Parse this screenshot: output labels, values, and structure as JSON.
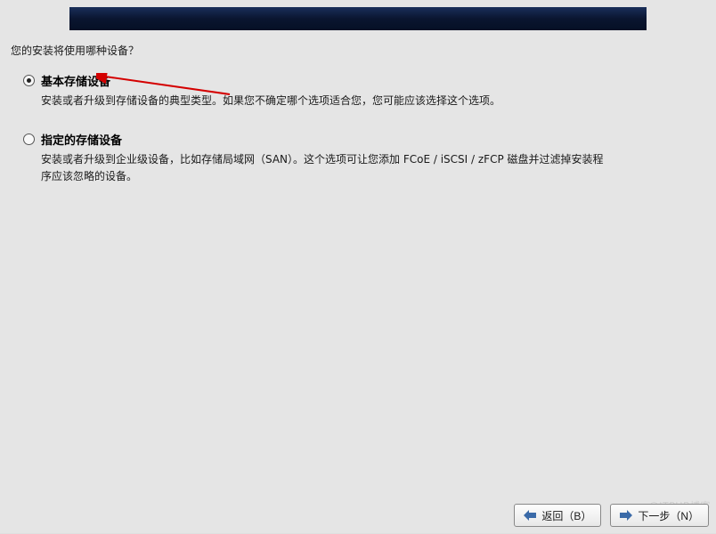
{
  "question": "您的安装将使用哪种设备？",
  "options": [
    {
      "title": "基本存储设备",
      "desc": "安装或者升级到存储设备的典型类型。如果您不确定哪个选项适合您，您可能应该选择这个选项。",
      "checked": true
    },
    {
      "title": "指定的存储设备",
      "desc": "安装或者升级到企业级设备，比如存储局域网（SAN）。这个选项可让您添加 FCoE / iSCSI / zFCP 磁盘并过滤掉安装程序应该忽略的设备。",
      "checked": false
    }
  ],
  "buttons": {
    "back": "返回（B）",
    "next": "下一步（N）"
  },
  "watermark": "@ITPUB博客"
}
